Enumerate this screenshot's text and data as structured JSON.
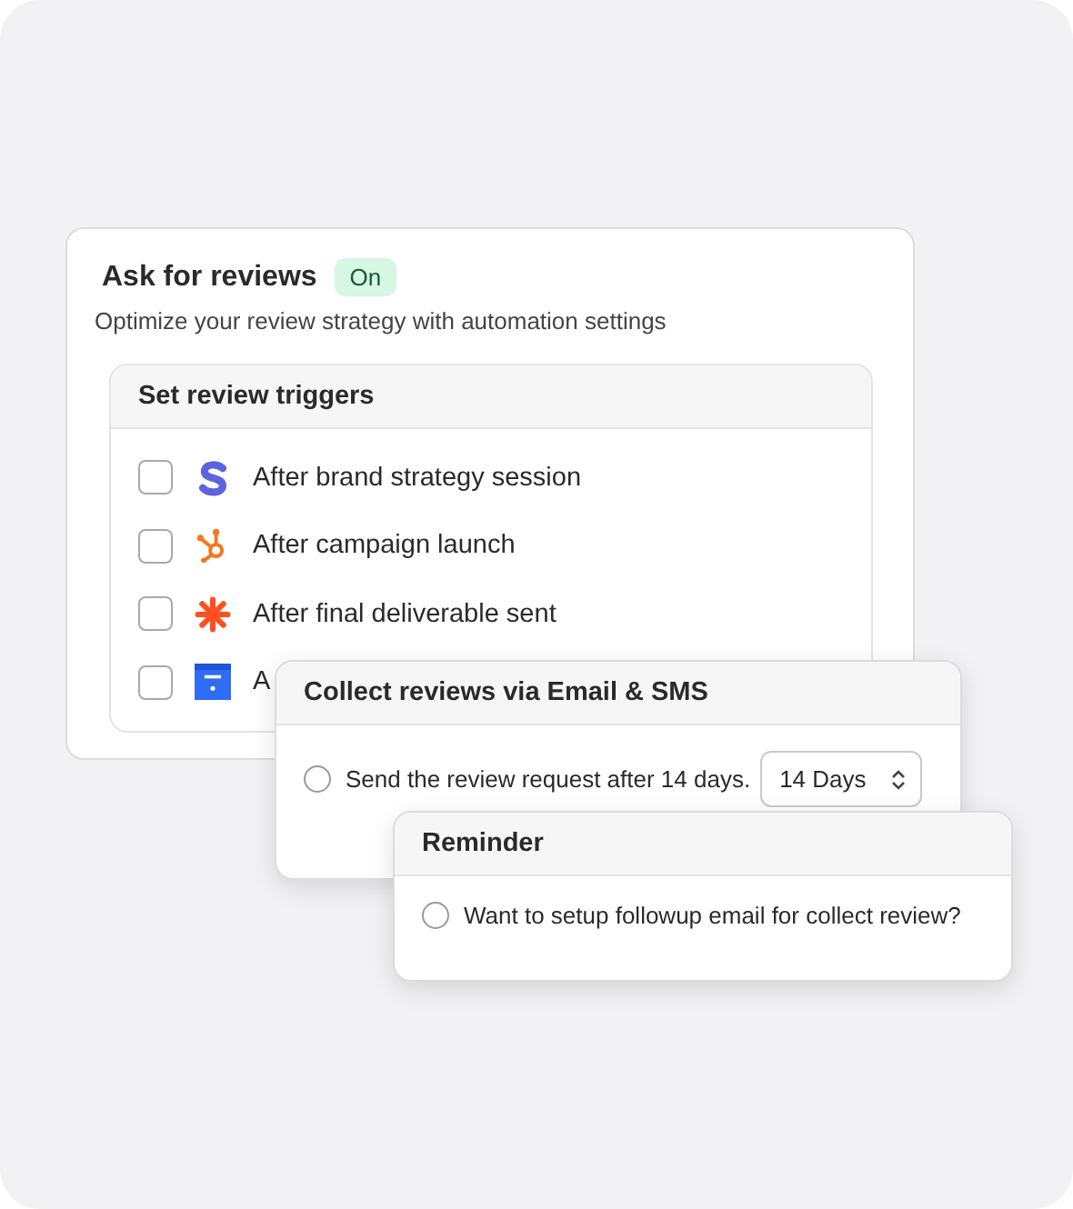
{
  "settings_card": {
    "title": "Ask for reviews",
    "status_badge": "On",
    "subtitle": "Optimize your review strategy with automation settings",
    "triggers": {
      "title": "Set review triggers",
      "items": [
        {
          "label": "After brand strategy session",
          "checked": false
        },
        {
          "label": "After campaign launch",
          "checked": false
        },
        {
          "label": "After final deliverable sent",
          "checked": false
        },
        {
          "label": "A",
          "checked": false
        }
      ]
    }
  },
  "collect_card": {
    "title": "Collect reviews via Email & SMS",
    "option": {
      "label": "Send the review request after 14 days.",
      "selected": false
    },
    "select_value": "14 Days"
  },
  "reminder_card": {
    "title": "Reminder",
    "option": {
      "label": "Want to setup followup email for collect review?",
      "selected": false
    }
  }
}
